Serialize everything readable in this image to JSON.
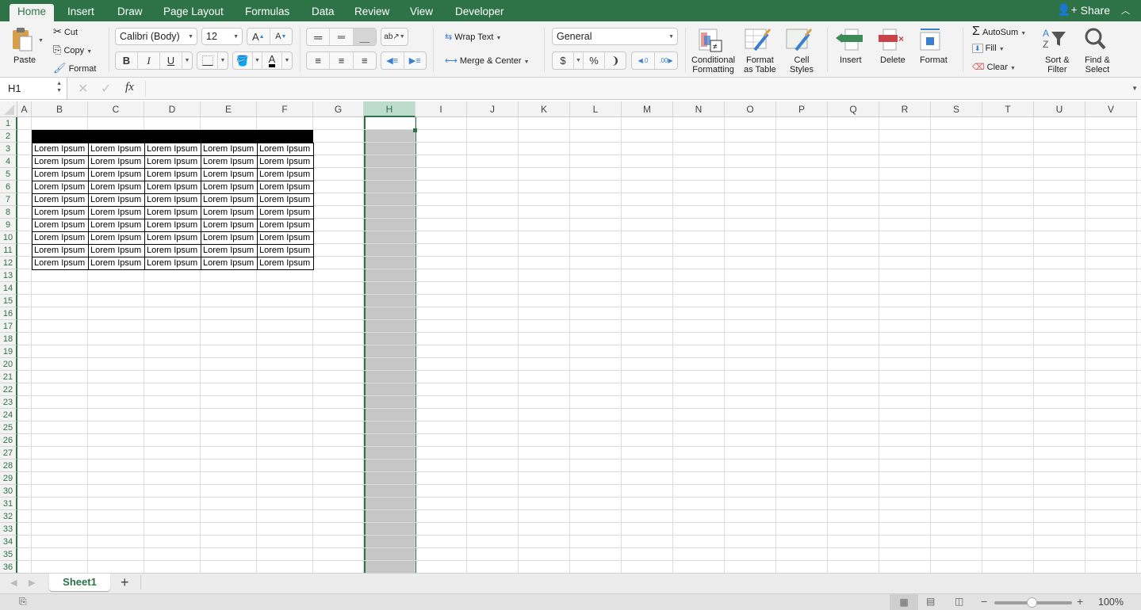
{
  "ribbon_tabs": [
    "Home",
    "Insert",
    "Draw",
    "Page Layout",
    "Formulas",
    "Data",
    "Review",
    "View",
    "Developer"
  ],
  "active_tab": "Home",
  "share_label": "Share",
  "clipboard": {
    "paste": "Paste",
    "cut": "Cut",
    "copy": "Copy",
    "format": "Format"
  },
  "font": {
    "name": "Calibri (Body)",
    "size": "12",
    "bold": "B",
    "italic": "I",
    "underline": "U",
    "font_color": "#000000"
  },
  "alignment": {
    "wrap_text": "Wrap Text",
    "merge_center": "Merge & Center"
  },
  "number": {
    "format": "General",
    "currency": "$",
    "percent": "%",
    "comma": "❩",
    "inc_decimal": ".0\n.00",
    "dec_decimal": ".00\n.0"
  },
  "styles": {
    "conditional": [
      "Conditional",
      "Formatting"
    ],
    "format_table": [
      "Format",
      "as Table"
    ],
    "cell_styles": [
      "Cell",
      "Styles"
    ]
  },
  "cells": {
    "insert": "Insert",
    "delete": "Delete",
    "format": "Format"
  },
  "editing": {
    "autosum": "AutoSum",
    "fill": "Fill",
    "clear": "Clear",
    "sort": [
      "Sort &",
      "Filter"
    ],
    "find": [
      "Find &",
      "Select"
    ]
  },
  "formula_bar": {
    "name_box": "H1",
    "fx": "fx",
    "formula": ""
  },
  "columns": [
    "A",
    "B",
    "C",
    "D",
    "E",
    "F",
    "G",
    "H",
    "I",
    "J",
    "K",
    "L",
    "M",
    "N",
    "O",
    "P",
    "Q",
    "R",
    "S",
    "T",
    "U",
    "V"
  ],
  "selected_column": "H",
  "rows": [
    1,
    2,
    3,
    4,
    5,
    6,
    7,
    8,
    9,
    10,
    11,
    12,
    13,
    14,
    15,
    16,
    17,
    18,
    19,
    20,
    21,
    22,
    23,
    24,
    25,
    26,
    27,
    28,
    29,
    30,
    31,
    32,
    33,
    34,
    35,
    36
  ],
  "table": {
    "header_row_fill": "#000000",
    "cell_text": "Lorem Ipsum",
    "data": [
      [
        "Lorem Ipsum",
        "Lorem Ipsum",
        "Lorem Ipsum",
        "Lorem Ipsum",
        "Lorem Ipsum"
      ],
      [
        "Lorem Ipsum",
        "Lorem Ipsum",
        "Lorem Ipsum",
        "Lorem Ipsum",
        "Lorem Ipsum"
      ],
      [
        "Lorem Ipsum",
        "Lorem Ipsum",
        "Lorem Ipsum",
        "Lorem Ipsum",
        "Lorem Ipsum"
      ],
      [
        "Lorem Ipsum",
        "Lorem Ipsum",
        "Lorem Ipsum",
        "Lorem Ipsum",
        "Lorem Ipsum"
      ],
      [
        "Lorem Ipsum",
        "Lorem Ipsum",
        "Lorem Ipsum",
        "Lorem Ipsum",
        "Lorem Ipsum"
      ],
      [
        "Lorem Ipsum",
        "Lorem Ipsum",
        "Lorem Ipsum",
        "Lorem Ipsum",
        "Lorem Ipsum"
      ],
      [
        "Lorem Ipsum",
        "Lorem Ipsum",
        "Lorem Ipsum",
        "Lorem Ipsum",
        "Lorem Ipsum"
      ],
      [
        "Lorem Ipsum",
        "Lorem Ipsum",
        "Lorem Ipsum",
        "Lorem Ipsum",
        "Lorem Ipsum"
      ],
      [
        "Lorem Ipsum",
        "Lorem Ipsum",
        "Lorem Ipsum",
        "Lorem Ipsum",
        "Lorem Ipsum"
      ],
      [
        "Lorem Ipsum",
        "Lorem Ipsum",
        "Lorem Ipsum",
        "Lorem Ipsum",
        "Lorem Ipsum"
      ]
    ]
  },
  "sheets": [
    "Sheet1"
  ],
  "add_sheet": "+",
  "zoom": {
    "label": "100%",
    "value_percent": 100
  },
  "colors": {
    "accent": "#2e7347",
    "selected_col_fill": "#c6c6c6",
    "header_sel": "#bddccb"
  }
}
